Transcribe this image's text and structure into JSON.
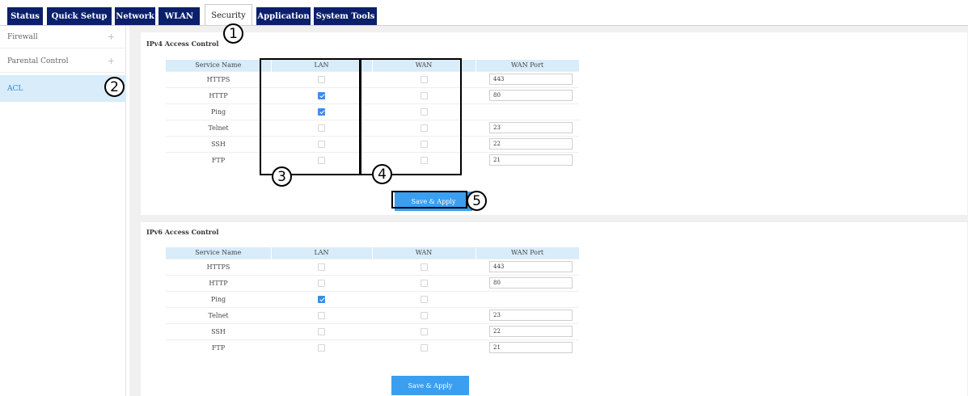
{
  "nav": {
    "tabs": [
      {
        "label": "Status"
      },
      {
        "label": "Quick Setup"
      },
      {
        "label": "Network"
      },
      {
        "label": "WLAN"
      },
      {
        "label": "Security"
      },
      {
        "label": "Application"
      },
      {
        "label": "System Tools"
      }
    ],
    "active_tab": "Security"
  },
  "sidebar": {
    "items": [
      {
        "label": "Firewall",
        "icon": "plus-icon"
      },
      {
        "label": "Parental Control",
        "icon": "plus-icon"
      },
      {
        "label": "ACL"
      }
    ],
    "active_item": "ACL"
  },
  "ipv4": {
    "title": "IPv4 Access Control",
    "columns": [
      "Service Name",
      "LAN",
      "WAN",
      "WAN Port"
    ],
    "rows": [
      {
        "service": "HTTPS",
        "lan": false,
        "wan": false,
        "port": "443"
      },
      {
        "service": "HTTP",
        "lan": true,
        "wan": false,
        "port": "80"
      },
      {
        "service": "Ping",
        "lan": true,
        "wan": false,
        "port": null
      },
      {
        "service": "Telnet",
        "lan": false,
        "wan": false,
        "port": "23"
      },
      {
        "service": "SSH",
        "lan": false,
        "wan": false,
        "port": "22"
      },
      {
        "service": "FTP",
        "lan": false,
        "wan": false,
        "port": "21"
      }
    ],
    "save_label": "Save & Apply"
  },
  "ipv6": {
    "title": "IPv6 Access Control",
    "columns": [
      "Service Name",
      "LAN",
      "WAN",
      "WAN Port"
    ],
    "rows": [
      {
        "service": "HTTPS",
        "lan": false,
        "wan": false,
        "port": "443"
      },
      {
        "service": "HTTP",
        "lan": false,
        "wan": false,
        "port": "80"
      },
      {
        "service": "Ping",
        "lan": true,
        "wan": false,
        "port": null
      },
      {
        "service": "Telnet",
        "lan": false,
        "wan": false,
        "port": "23"
      },
      {
        "service": "SSH",
        "lan": false,
        "wan": false,
        "port": "22"
      },
      {
        "service": "FTP",
        "lan": false,
        "wan": false,
        "port": "21"
      }
    ],
    "save_label": "Save & Apply"
  },
  "annotations": [
    "1",
    "2",
    "3",
    "4",
    "5"
  ],
  "colors": {
    "nav_tab": "#0b1f6b",
    "accent": "#3a9ff0",
    "checkbox_checked": "#3a8ee6",
    "header_row": "#d8ecfa",
    "background": "#f0f0f0"
  }
}
